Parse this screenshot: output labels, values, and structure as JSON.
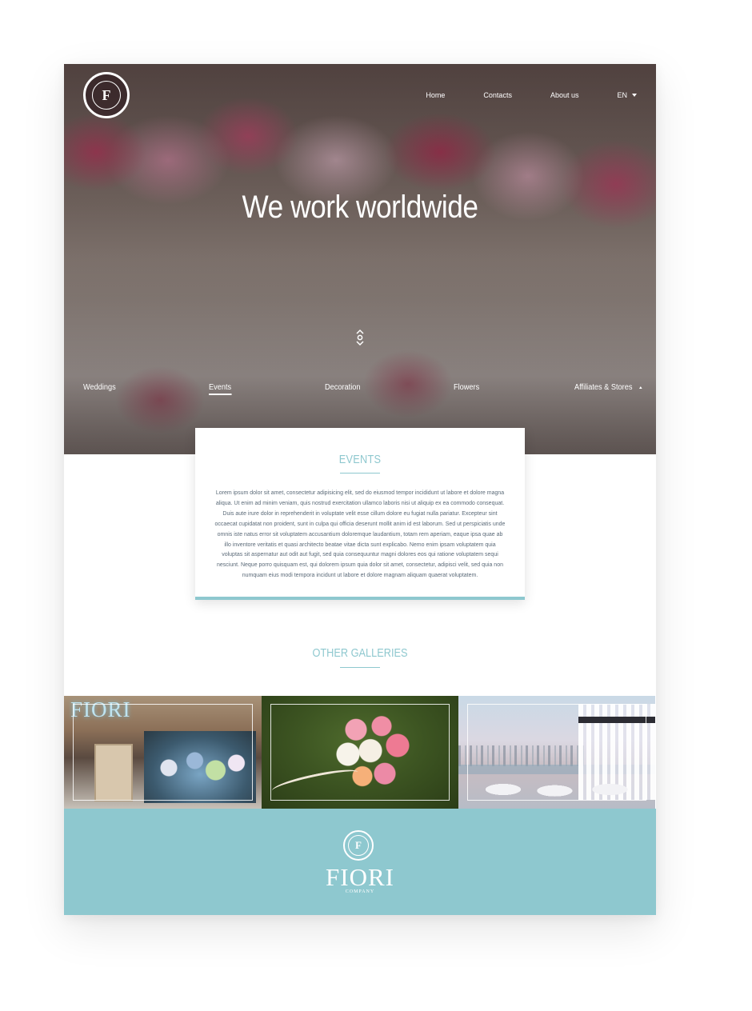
{
  "header": {
    "logo_icon": "fiori-seal-icon",
    "logo_monogram": "F",
    "nav": [
      {
        "label": "Home"
      },
      {
        "label": "Contacts"
      },
      {
        "label": "About us"
      }
    ],
    "language": "EN"
  },
  "hero": {
    "title": "We work worldwide",
    "scroll_icon": "scroll-down-icon"
  },
  "categories": [
    {
      "label": "Weddings",
      "active": false
    },
    {
      "label": "Events",
      "active": true
    },
    {
      "label": "Decoration",
      "active": false
    },
    {
      "label": "Flowers",
      "active": false
    },
    {
      "label": "Affiliates & Stores",
      "active": false,
      "has_dropdown": true
    }
  ],
  "events_card": {
    "title": "EVENTS",
    "body": "Lorem ipsum dolor sit amet, consectetur adipisicing elit, sed do eiusmod tempor incididunt ut labore et dolore magna aliqua. Ut enim ad minim veniam, quis nostrud exercitation ullamco laboris nisi ut aliquip ex ea commodo consequat. Duis aute irure dolor in reprehenderit in voluptate velit esse cillum dolore eu fugiat nulla pariatur. Excepteur sint occaecat cupidatat non proident, sunt in culpa qui officia deserunt mollit anim id est laborum. Sed ut perspiciatis unde omnis iste natus error sit voluptatem accusantium doloremque laudantium, totam rem aperiam, eaque ipsa quae ab illo inventore veritatis et quasi architecto beatae vitae dicta sunt explicabo. Nemo enim ipsam voluptatem quia voluptas sit aspernatur aut odit aut fugit, sed quia consequuntur magni dolores eos qui ratione voluptatem sequi nesciunt. Neque porro quisquam est, qui dolorem ipsum quia dolor sit amet, consectetur, adipisci velit, sed quia non numquam eius modi tempora incidunt ut labore et dolore magnam aliquam quaerat voluptatem."
  },
  "galleries": {
    "title": "OTHER GALLERIES",
    "tiles": [
      {
        "name": "store",
        "sign": "FIORI"
      },
      {
        "name": "bouquet"
      },
      {
        "name": "venue"
      }
    ]
  },
  "footer": {
    "monogram": "F",
    "brand": "FIORI",
    "sub": "COMPANY"
  },
  "colors": {
    "accent": "#8ec8cf",
    "body_text": "#5b6a78",
    "white": "#ffffff"
  }
}
